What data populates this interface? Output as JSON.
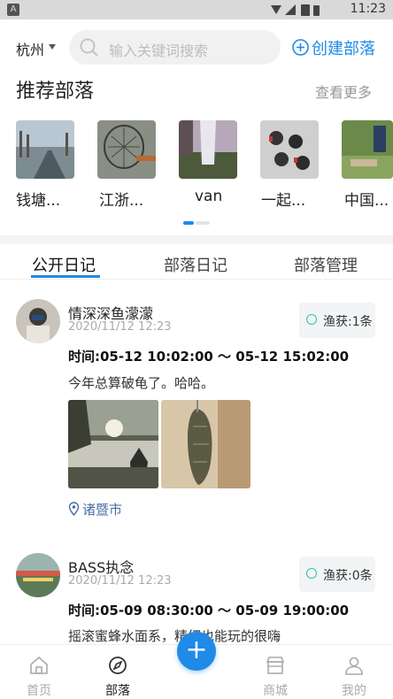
{
  "status_bar": {
    "time": "11:23"
  },
  "header": {
    "city": "杭州",
    "search_placeholder": "输入关键词搜索",
    "create_label": "创建部落"
  },
  "recommended": {
    "title": "推荐部落",
    "more": "查看更多",
    "items": [
      {
        "label": "钱塘..."
      },
      {
        "label": "江浙..."
      },
      {
        "label": "van"
      },
      {
        "label": "一起..."
      },
      {
        "label": "中国..."
      }
    ]
  },
  "tabs": [
    {
      "label": "公开日记"
    },
    {
      "label": "部落日记"
    },
    {
      "label": "部落管理"
    }
  ],
  "posts": [
    {
      "user": "情深深鱼濛濛",
      "date": "2020/11/12 12:23",
      "catch": "渔获:1条",
      "time_prefix": "时间:",
      "time_range": "05-12 10:02:00 ～ 05-12 15:02:00",
      "content": "今年总算破龟了。哈哈。",
      "location": "诸暨市"
    },
    {
      "user": "BASS执念",
      "date": "2020/11/12 12:23",
      "catch": "渔获:0条",
      "time_prefix": "时间:",
      "time_range": "05-09 08:30:00 ～ 05-09 19:00:00",
      "content": "摇滚蜜蜂水面系，精细也能玩的很嗨"
    }
  ],
  "bottom_nav": [
    {
      "label": "首页",
      "icon": "home-icon"
    },
    {
      "label": "部落",
      "icon": "compass-icon"
    },
    {
      "label": "商城",
      "icon": "shop-icon"
    },
    {
      "label": "我的",
      "icon": "user-icon"
    }
  ],
  "fab": {
    "label": "+"
  },
  "colors": {
    "accent": "#1f8ae8",
    "check": "#2bc4a8"
  }
}
